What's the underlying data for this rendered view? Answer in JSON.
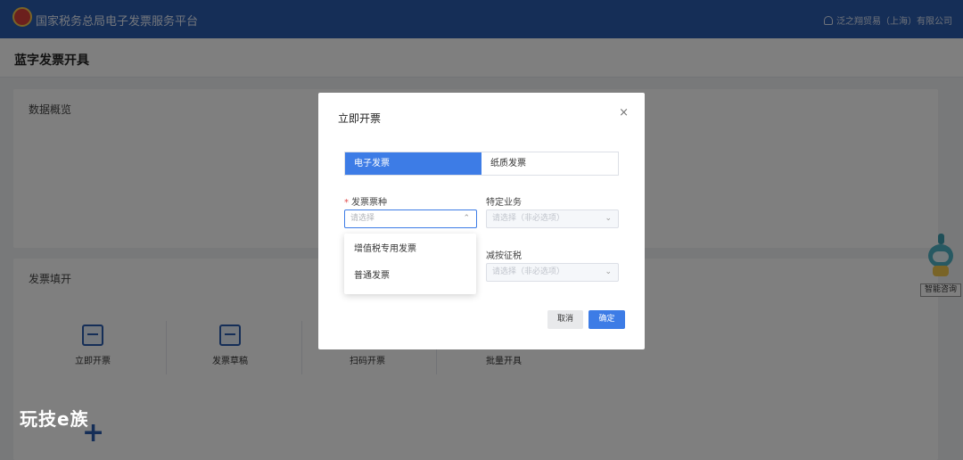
{
  "header": {
    "app_title": "国家税务总局电子发票服务平台",
    "user_name": "泛之翔贸易（上海）有限公司"
  },
  "page": {
    "title": "蓝字发票开具"
  },
  "overview": {
    "title": "数据概览"
  },
  "invoice_fill": {
    "title": "发票填开",
    "actions": [
      {
        "label": "立即开票"
      },
      {
        "label": "发票草稿"
      },
      {
        "label": "扫码开票"
      },
      {
        "label": "批量开具"
      }
    ]
  },
  "assistant": {
    "label": "智能咨询"
  },
  "watermark": {
    "text": "玩技e族"
  },
  "modal": {
    "title": "立即开票",
    "close": "×",
    "tabs": [
      {
        "label": "电子发票",
        "active": true
      },
      {
        "label": "纸质发票",
        "active": false
      }
    ],
    "invoice_type": {
      "label": "发票票种",
      "required_mark": "*",
      "placeholder": "请选择",
      "options": [
        "增值税专用发票",
        "普通发票"
      ]
    },
    "special_business": {
      "label": "特定业务",
      "placeholder": "请选择（非必选项）"
    },
    "tax_reduction": {
      "label": "减按征税",
      "placeholder": "请选择（非必选项）"
    },
    "cancel_label": "取消",
    "confirm_label": "确定"
  },
  "icons": {
    "chevron_up": "⌃",
    "chevron_down": "⌄",
    "plus": "+"
  }
}
